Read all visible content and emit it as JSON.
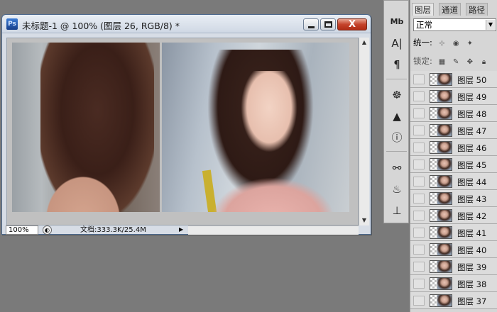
{
  "document": {
    "title": "未标题-1 @ 100% (图层 26, RGB/8) *",
    "app_badge": "Ps",
    "zoom": "100%",
    "doc_info": "文档:333.3K/25.4M",
    "close_glyph": "X"
  },
  "tools": [
    {
      "name": "mini-bridge-icon",
      "glyph": "Mb"
    },
    {
      "name": "character-icon",
      "glyph": "A|"
    },
    {
      "name": "paragraph-icon",
      "glyph": "¶"
    },
    {
      "name": "navigator-icon",
      "glyph": "☸"
    },
    {
      "name": "histogram-icon",
      "glyph": "▲"
    },
    {
      "name": "info-icon",
      "glyph": "ⓘ"
    },
    {
      "name": "brushes-icon",
      "glyph": "⚯"
    },
    {
      "name": "clone-source-icon",
      "glyph": "♨"
    },
    {
      "name": "stamp-icon",
      "glyph": "⊥"
    }
  ],
  "panel": {
    "tabs": [
      {
        "label": "图层",
        "active": true
      },
      {
        "label": "通道",
        "active": false
      },
      {
        "label": "路径",
        "active": false
      }
    ],
    "blend_mode": "正常",
    "unify_label": "统一:",
    "lock_label": "锁定:"
  },
  "layers": [
    {
      "name": "图层 50"
    },
    {
      "name": "图层 49"
    },
    {
      "name": "图层 48"
    },
    {
      "name": "图层 47"
    },
    {
      "name": "图层 46"
    },
    {
      "name": "图层 45"
    },
    {
      "name": "图层 44"
    },
    {
      "name": "图层 43"
    },
    {
      "name": "图层 42"
    },
    {
      "name": "图层 41"
    },
    {
      "name": "图层 40"
    },
    {
      "name": "图层 39"
    },
    {
      "name": "图层 38"
    },
    {
      "name": "图层 37"
    }
  ]
}
